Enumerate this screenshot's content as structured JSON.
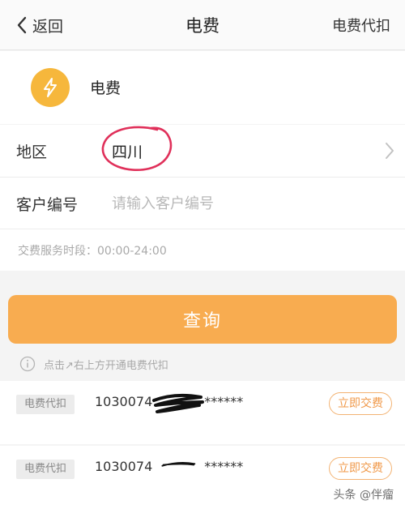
{
  "nav": {
    "back_label": "返回",
    "title": "电费",
    "action_label": "电费代扣"
  },
  "biz": {
    "name": "电费",
    "icon": "lightning-icon",
    "icon_color": "#f6b73c"
  },
  "form": {
    "region_label": "地区",
    "region_value": "四川",
    "customer_label": "客户编号",
    "customer_placeholder": "请输入客户编号",
    "customer_value": ""
  },
  "hours_text": "交费服务时段：00:00-24:00",
  "query_label": "查询",
  "query_color": "#f8ac50",
  "tip_text": "点击↗右上方开通电费代扣",
  "accounts": [
    {
      "tag": "电费代扣",
      "number": "1030074",
      "masked": "******",
      "pay_label": "立即交费"
    },
    {
      "tag": "电费代扣",
      "number": "1030074",
      "masked": "******",
      "pay_label": "立即交费"
    }
  ],
  "watermark": "头条 @伴瘤"
}
